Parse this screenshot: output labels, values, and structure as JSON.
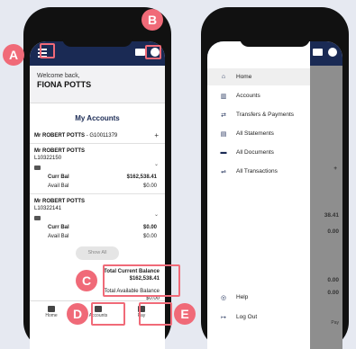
{
  "left_phone": {
    "welcome_line": "Welcome back,",
    "user_name": "FIONA POTTS",
    "section_title": "My Accounts",
    "group": {
      "holder": "Mr ROBERT POTTS",
      "id": "- G10011379",
      "plus": "+"
    },
    "accounts": [
      {
        "holder": "Mr ROBERT POTTS",
        "number": "L10322150",
        "curr_label": "Curr Bal",
        "curr_value": "$162,538.41",
        "avail_label": "Avail Bal",
        "avail_value": "$0.00"
      },
      {
        "holder": "Mr ROBERT POTTS",
        "number": "L10322141",
        "curr_label": "Curr Bal",
        "curr_value": "$0.00",
        "avail_label": "Avail Bal",
        "avail_value": "$0.00"
      }
    ],
    "show_all": "Show All",
    "total_current_label": "Total Current Balance",
    "total_current_value": "$162,538.41",
    "total_available_label": "Total Available Balance",
    "total_available_value": "$0.00",
    "nav": [
      {
        "label": "Home",
        "icon": "home-icon"
      },
      {
        "label": "Accounts",
        "icon": "bank-icon"
      },
      {
        "label": "Pay",
        "icon": "transfer-icon"
      }
    ]
  },
  "right_phone": {
    "menu": [
      {
        "label": "Home",
        "icon": "home-icon"
      },
      {
        "label": "Accounts",
        "icon": "bank-icon"
      },
      {
        "label": "Transfers & Payments",
        "icon": "transfer-icon"
      },
      {
        "label": "All Statements",
        "icon": "document-icon"
      },
      {
        "label": "All Documents",
        "icon": "folder-icon"
      },
      {
        "label": "All Transactions",
        "icon": "transactions-icon"
      }
    ],
    "footer": [
      {
        "label": "Help",
        "icon": "help-icon"
      },
      {
        "label": "Log Out",
        "icon": "logout-icon"
      }
    ],
    "behind": {
      "plus": "+",
      "value1": "38.41",
      "value2": "0.00",
      "value3": "0.00",
      "value4": "0.00",
      "pay": "Pay"
    }
  },
  "callouts": {
    "a": "A",
    "b": "B",
    "c": "C",
    "d": "D",
    "e": "E"
  },
  "colors": {
    "navy": "#1a2a54",
    "highlight": "#f06a78",
    "background": "#e6e9f1"
  }
}
